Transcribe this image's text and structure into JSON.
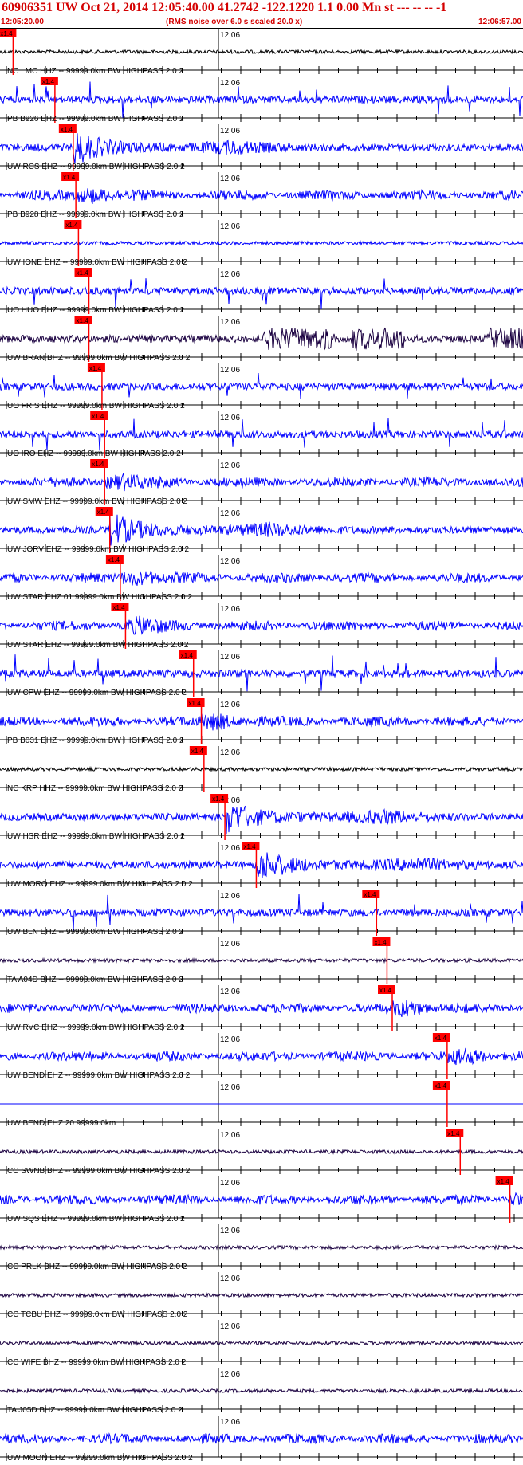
{
  "header": {
    "title": "60906351 UW Oct 21, 2014 12:05:40.00   41.2742 -122.1220  1.1 0.00 Mn st --- -- --   -1",
    "start_time": "12:05:20.00",
    "scale_note": "(RMS noise over 6.0 s scaled 20.0 x)",
    "end_time": "12:06:57.00"
  },
  "time_mark_label": "12:06",
  "pick_label": "x1.4",
  "colors": {
    "header": "#d40000",
    "trace_blue": "#0000ff",
    "trace_dark": "#1a0040",
    "trace_black": "#000000",
    "pick": "#ff0000"
  },
  "traces": [
    {
      "label": "NC LMC HHZ -- 99999.0km BW  HIGHPASS  2.0  2",
      "color": "black",
      "pick": 0.025,
      "style": "quiet"
    },
    {
      "label": "PB B926 EHZ -- 99999.0km BW  HIGHPASS  2.0  2",
      "color": "blue",
      "pick": 0.105,
      "style": "spiky"
    },
    {
      "label": "UW RCS EHZ -- 99999.0km BW  HIGHPASS  2.0  2",
      "color": "blue",
      "pick": 0.14,
      "style": "event"
    },
    {
      "label": "PB B928 EHZ -- 99999.0km BW  HIGHPASS  2.0  2",
      "color": "blue",
      "pick": 0.145,
      "style": "noise"
    },
    {
      "label": "UW IONE EHZ -- 99999.0km BW  HIGHPASS  2.0  2",
      "color": "blue",
      "pick": 0.15,
      "style": "quiet"
    },
    {
      "label": "UO HUO EHZ -- 99999.0km BW  HIGHPASS  2.0  2",
      "color": "blue",
      "pick": 0.17,
      "style": "spiky"
    },
    {
      "label": "UW BRAN BHZ -- 99999.0km BW  HIGHPASS  2.0  2",
      "color": "dark",
      "pick": 0.17,
      "style": "bursts"
    },
    {
      "label": "UO FRIS EHZ -- 99999.0km BW  HIGHPASS  2.0  2",
      "color": "blue",
      "pick": 0.195,
      "style": "spiky"
    },
    {
      "label": "UO IRO EHZ -- 99999.0km BW  HIGHPASS  2.0  2",
      "color": "blue",
      "pick": 0.2,
      "style": "spiky"
    },
    {
      "label": "UW SMW EHZ -- 99999.0km BW  HIGHPASS  2.0  2",
      "color": "blue",
      "pick": 0.2,
      "style": "noise"
    },
    {
      "label": "UW JORV EHZ -- 99999.0km BW  HIGHPASS  2.0  2",
      "color": "blue",
      "pick": 0.21,
      "style": "event"
    },
    {
      "label": "UW STAR EHZ 01 99999.0km BW  HIGHPASS  2.0  2",
      "color": "blue",
      "pick": 0.23,
      "style": "noise"
    },
    {
      "label": "UW STAR EHZ -- 99999.0km BW  HIGHPASS  2.0  2",
      "color": "blue",
      "pick": 0.24,
      "style": "noise"
    },
    {
      "label": "UW CPW EHZ -- 99999.0km BW  HIGHPASS  2.0  2",
      "color": "blue",
      "pick": 0.37,
      "style": "spiky"
    },
    {
      "label": "PB B031 EHZ -- 99999.0km BW  HIGHPASS  2.0  2",
      "color": "blue",
      "pick": 0.385,
      "style": "noise"
    },
    {
      "label": "NC KRP HHZ -- 99999.0km BW  HIGHPASS  2.0  2",
      "color": "black",
      "pick": 0.39,
      "style": "quiet"
    },
    {
      "label": "UW HSR EHZ -- 99999.0km BW  HIGHPASS  2.0  2",
      "color": "blue",
      "pick": 0.43,
      "style": "event"
    },
    {
      "label": "UW MORO EHZ -- 99999.0km BW  HIGHPASS  2.0  2",
      "color": "blue",
      "pick": 0.49,
      "style": "event"
    },
    {
      "label": "UW BLN EHZ -- 99999.0km BW  HIGHPASS  2.0  2",
      "color": "blue",
      "pick": 0.72,
      "style": "spiky"
    },
    {
      "label": "TA A04D BHZ -- 99999.0km BW  HIGHPASS  2.0  2",
      "color": "dark",
      "pick": 0.74,
      "style": "quiet"
    },
    {
      "label": "UW RVC EHZ -- 99999.0km BW  HIGHPASS  2.0  2",
      "color": "blue",
      "pick": 0.75,
      "style": "noise"
    },
    {
      "label": "UW BEND EHZ -- 99999.0km BW  HIGHPASS  2.0  2",
      "color": "blue",
      "pick": 0.855,
      "style": "noise"
    },
    {
      "label": "UW BEND EHZ 20 99999.0km",
      "color": "blue",
      "pick": 0.855,
      "style": "flat"
    },
    {
      "label": "CC SWNB BHZ -- 99999.0km BW  HIGHPASS  2.0  2",
      "color": "dark",
      "pick": 0.88,
      "style": "quiet"
    },
    {
      "label": "UW SQS EHZ -- 99999.0km BW  HIGHPASS  2.0  2",
      "color": "blue",
      "pick": 0.975,
      "style": "noise"
    },
    {
      "label": "CC PRLK BHZ -- 99999.0km BW  HIGHPASS  2.0  2",
      "color": "dark",
      "pick": null,
      "style": "quiet"
    },
    {
      "label": "CC TCBU BHZ -- 99999.0km BW  HIGHPASS  2.0  2",
      "color": "dark",
      "pick": null,
      "style": "quiet"
    },
    {
      "label": "CC WIFE BHZ -- 99999.0km BW  HIGHPASS  2.0  2",
      "color": "dark",
      "pick": null,
      "style": "quiet"
    },
    {
      "label": "TA J05D BHZ -- 99999.0km BW  HIGHPASS  2.0  2",
      "color": "dark",
      "pick": null,
      "style": "quiet"
    },
    {
      "label": "UW MOON EHZ -- 99999.0km BW  HIGHPASS  2.0  2",
      "color": "blue",
      "pick": null,
      "style": "noise"
    }
  ]
}
